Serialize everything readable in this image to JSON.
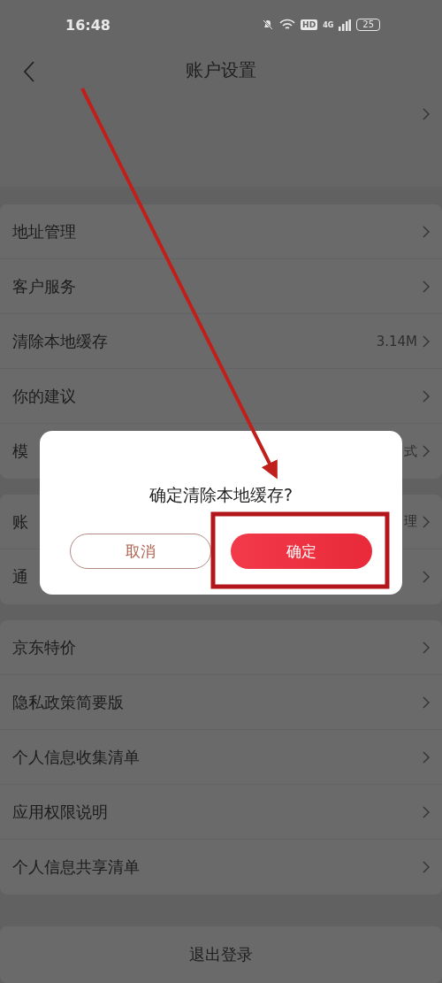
{
  "status_bar": {
    "time": "16:48",
    "hd": "HD",
    "network": "4G",
    "battery": "25"
  },
  "nav": {
    "title": "账户设置"
  },
  "groups": [
    {
      "rows": [
        {
          "label": "地址管理"
        },
        {
          "label": "客户服务"
        },
        {
          "label": "清除本地缓存",
          "value": "3.14M"
        },
        {
          "label": "你的建议"
        },
        {
          "label": "模",
          "value": "式"
        }
      ]
    },
    {
      "rows": [
        {
          "label": "账",
          "value": "理"
        },
        {
          "label": "通"
        }
      ]
    },
    {
      "rows": [
        {
          "label": "京东特价"
        },
        {
          "label": "隐私政策简要版"
        },
        {
          "label": "个人信息收集清单"
        },
        {
          "label": "应用权限说明"
        },
        {
          "label": "个人信息共享清单"
        }
      ]
    }
  ],
  "logout": "退出登录",
  "dialog": {
    "message": "确定清除本地缓存?",
    "buttons": [
      {
        "label": "取消",
        "kind": "secondary"
      },
      {
        "label": "确定",
        "kind": "primary"
      }
    ]
  }
}
